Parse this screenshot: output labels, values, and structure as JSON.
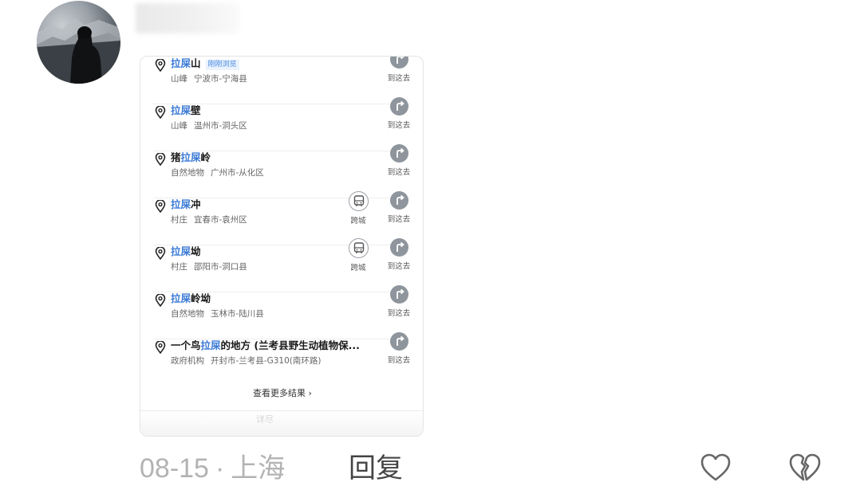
{
  "results": [
    {
      "title_hl": "拉屎",
      "title_rest": "山",
      "title_prefix": "",
      "tag": "刚刚浏览",
      "category": "山峰",
      "location": "宁波市-宁海县",
      "cross_city": false,
      "go_label": "到这去"
    },
    {
      "title_hl": "拉屎",
      "title_rest": "壁",
      "title_prefix": "",
      "tag": "",
      "category": "山峰",
      "location": "温州市-洞头区",
      "cross_city": false,
      "go_label": "到这去"
    },
    {
      "title_hl": "拉屎",
      "title_rest": "岭",
      "title_prefix": "猪",
      "tag": "",
      "category": "自然地物",
      "location": "广州市-从化区",
      "cross_city": false,
      "go_label": "到这去"
    },
    {
      "title_hl": "拉屎",
      "title_rest": "冲",
      "title_prefix": "",
      "tag": "",
      "category": "村庄",
      "location": "宜春市-袁州区",
      "cross_city": true,
      "cross_label": "跨城",
      "go_label": "到这去"
    },
    {
      "title_hl": "拉屎",
      "title_rest": "坳",
      "title_prefix": "",
      "tag": "",
      "category": "村庄",
      "location": "邵阳市-洞口县",
      "cross_city": true,
      "cross_label": "跨城",
      "go_label": "到这去"
    },
    {
      "title_hl": "拉屎",
      "title_rest": "岭坳",
      "title_prefix": "",
      "tag": "",
      "category": "自然地物",
      "location": "玉林市-陆川县",
      "cross_city": false,
      "go_label": "到这去"
    },
    {
      "title_hl": "拉屎",
      "title_rest": "的地方 (兰考县野生动植物保...",
      "title_prefix": "一个鸟",
      "tag": "",
      "category": "政府机构",
      "location": "开封市-兰考县-G310(南环路)",
      "cross_city": false,
      "go_label": "到这去"
    }
  ],
  "more_label": "查看更多结果 ›",
  "faded_label": "详尽",
  "comment_meta": {
    "date": "08-15",
    "separator": "·",
    "location": "上海",
    "reply_label": "回复"
  },
  "icons": {
    "like": "heart-outline-icon",
    "dislike": "broken-heart-icon",
    "pin": "location-pin-icon",
    "go": "directions-icon",
    "bus": "bus-icon"
  },
  "colors": {
    "highlight": "#3d7bd6",
    "meta": "#b3b3b3",
    "go_button": "#8e959c"
  }
}
